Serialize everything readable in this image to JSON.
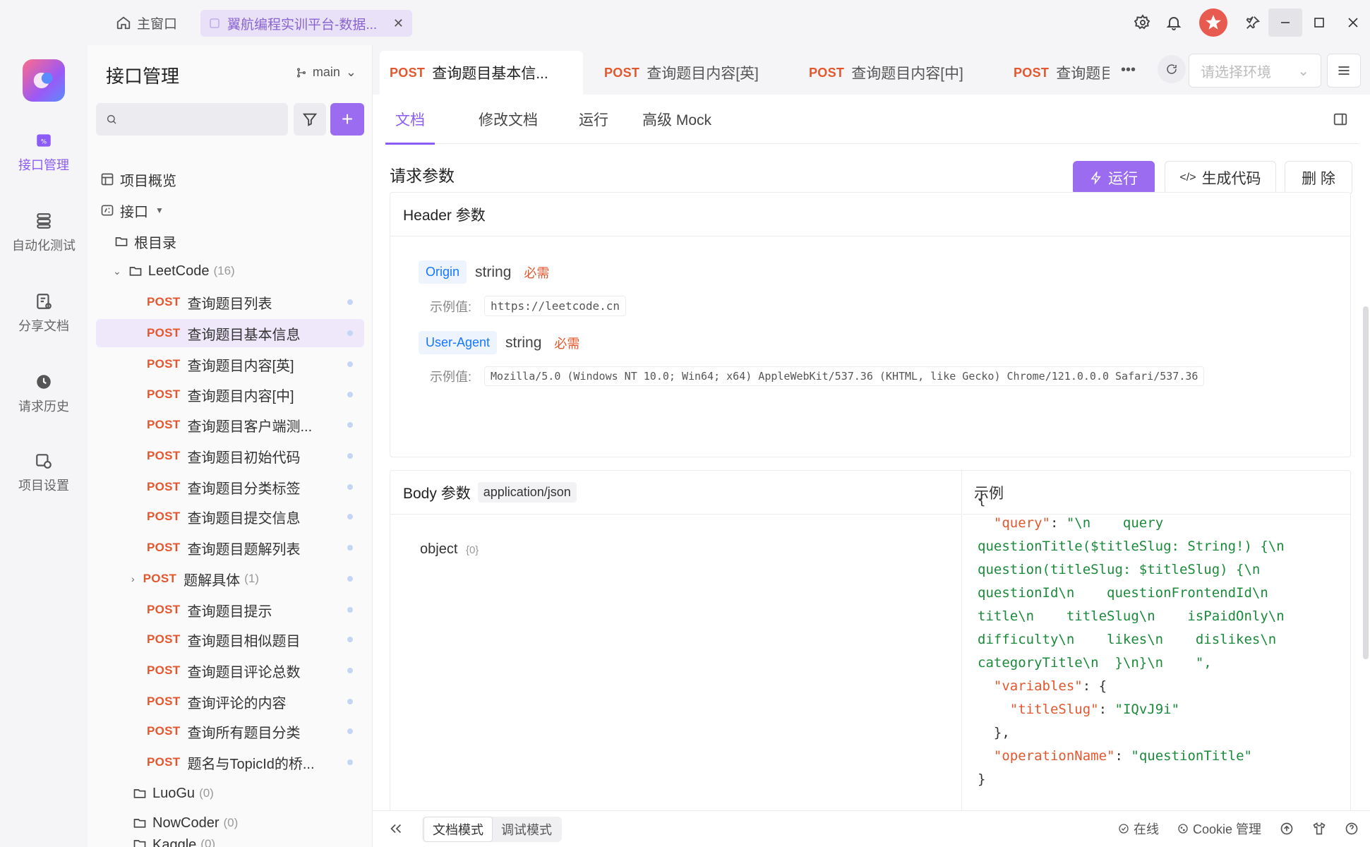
{
  "titlebar": {
    "home_label": "主窗口",
    "tab_title": "翼航编程实训平台-数据..."
  },
  "rail": {
    "items": [
      {
        "label": "接口管理",
        "icon": "api-icon",
        "active": true
      },
      {
        "label": "自动化测试",
        "icon": "automation-icon"
      },
      {
        "label": "分享文档",
        "icon": "share-doc-icon"
      },
      {
        "label": "请求历史",
        "icon": "history-icon"
      },
      {
        "label": "项目设置",
        "icon": "settings-icon"
      }
    ]
  },
  "sidebar": {
    "title": "接口管理",
    "branch": "main",
    "search_placeholder": "",
    "overview": "项目概览",
    "api_label": "接口",
    "root": "根目录",
    "folder_leetcode": "LeetCode",
    "folder_leetcode_count": "(16)",
    "method": "POST",
    "items": [
      "查询题目列表",
      "查询题目基本信息",
      "查询题目内容[英]",
      "查询题目内容[中]",
      "查询题目客户端测...",
      "查询题目初始代码",
      "查询题目分类标签",
      "查询题目提交信息",
      "查询题目题解列表",
      "题解具体",
      "查询题目提示",
      "查询题目相似题目",
      "查询题目评论总数",
      "查询评论的内容",
      "查询所有题目分类",
      "题名与TopicId的桥..."
    ],
    "subfolder_count": "(1)",
    "folder_luogu": "LuoGu",
    "folder_luogu_count": "(0)",
    "folder_nowcoder": "NowCoder",
    "folder_nowcoder_count": "(0)",
    "folder_kaggle": "Kaggle",
    "folder_kaggle_count": "(0)"
  },
  "tabs": {
    "method": "POST",
    "items": [
      "查询题目基本信...",
      "查询题目内容[英]",
      "查询题目内容[中]",
      "查询题目:"
    ],
    "env_placeholder": "请选择环境"
  },
  "subtabs": [
    "文档",
    "修改文档",
    "运行",
    "高级 Mock"
  ],
  "doc": {
    "section_title": "请求参数",
    "run_label": "运行",
    "gen_label": "生成代码",
    "del_label": "删 除",
    "header_title": "Header 参数",
    "example_label": "示例值:",
    "required": "必需",
    "headers": [
      {
        "name": "Origin",
        "type": "string",
        "example": "https://leetcode.cn"
      },
      {
        "name": "User-Agent",
        "type": "string",
        "example": "Mozilla/5.0 (Windows NT 10.0; Win64; x64) AppleWebKit/537.36 (KHTML, like Gecko) Chrome/121.0.0.0 Safari/537.36"
      }
    ],
    "body_title": "Body 参数",
    "content_type": "application/json",
    "body_type": "object",
    "body_count": "{0}",
    "example_title": "示例"
  },
  "example_json": {
    "l1": "{",
    "k_query": "\"query\"",
    "v_query_1": "\"\\n    query",
    "v_query_2": "questionTitle($titleSlug: String!) {\\n",
    "v_query_3": "question(titleSlug: $titleSlug) {\\n",
    "v_query_4": "questionId\\n    questionFrontendId\\n",
    "v_query_5": "title\\n    titleSlug\\n    isPaidOnly\\n",
    "v_query_6": "difficulty\\n    likes\\n    dislikes\\n",
    "v_query_7": "categoryTitle\\n  }\\n}\\n    \",",
    "k_variables": "\"variables\"",
    "k_titleslug": "\"titleSlug\"",
    "v_titleslug": "\"IQvJ9i\"",
    "k_opname": "\"operationName\"",
    "v_opname": "\"questionTitle\"",
    "close_inner": "},",
    "close": "}"
  },
  "bottombar": {
    "mode_doc": "文档模式",
    "mode_debug": "调试模式",
    "online": "在线",
    "cookie": "Cookie 管理"
  },
  "colors": {
    "accent": "#9b6cf0",
    "post": "#e4572e",
    "json_key": "#e4572e",
    "json_string": "#1b8a3a"
  }
}
